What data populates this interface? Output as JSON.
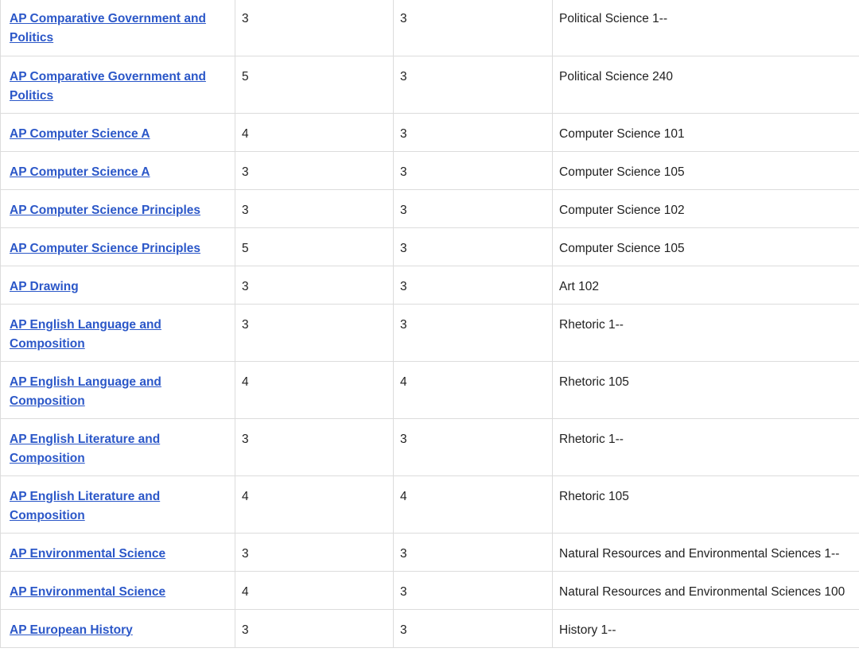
{
  "credit_table": {
    "rows": [
      {
        "exam": "AP Comparative Government and Politics",
        "score": "3",
        "hours": "3",
        "course": "Political Science 1--"
      },
      {
        "exam": "AP Comparative Government and Politics",
        "score": "5",
        "hours": "3",
        "course": "Political Science 240"
      },
      {
        "exam": "AP Computer Science A",
        "score": "4",
        "hours": "3",
        "course": "Computer Science 101"
      },
      {
        "exam": "AP Computer Science A",
        "score": "3",
        "hours": "3",
        "course": "Computer Science 105"
      },
      {
        "exam": "AP Computer Science Principles",
        "score": "3",
        "hours": "3",
        "course": "Computer Science 102"
      },
      {
        "exam": "AP Computer Science Principles",
        "score": "5",
        "hours": "3",
        "course": "Computer Science 105"
      },
      {
        "exam": "AP Drawing",
        "score": "3",
        "hours": "3",
        "course": "Art 102"
      },
      {
        "exam": "AP English Language and Composition",
        "score": "3",
        "hours": "3",
        "course": "Rhetoric 1--"
      },
      {
        "exam": "AP English Language and Composition",
        "score": "4",
        "hours": "4",
        "course": "Rhetoric 105"
      },
      {
        "exam": "AP English Literature and Composition",
        "score": "3",
        "hours": "3",
        "course": "Rhetoric 1--"
      },
      {
        "exam": "AP English Literature and Composition",
        "score": "4",
        "hours": "4",
        "course": "Rhetoric 105"
      },
      {
        "exam": "AP Environmental Science",
        "score": "3",
        "hours": "3",
        "course": "Natural Resources and Environmental Sciences 1--"
      },
      {
        "exam": "AP Environmental Science",
        "score": "4",
        "hours": "3",
        "course": "Natural Resources and Environmental Sciences 100"
      },
      {
        "exam": "AP European History",
        "score": "3",
        "hours": "3",
        "course": "History 1--"
      }
    ]
  }
}
